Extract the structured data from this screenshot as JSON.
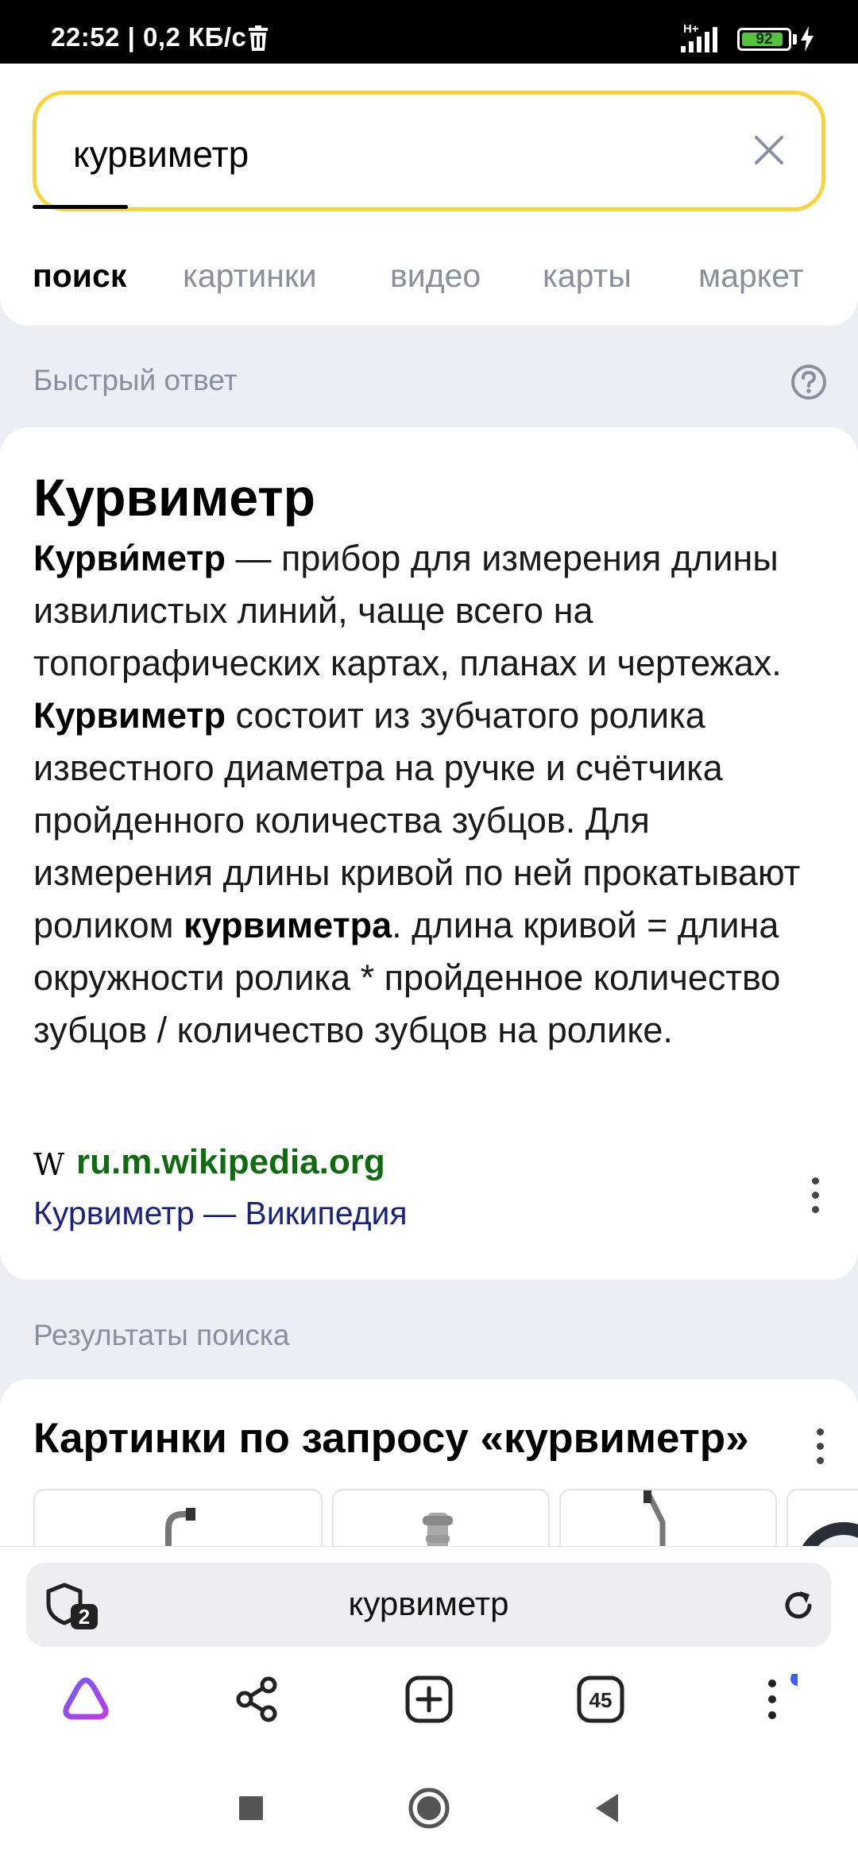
{
  "status_bar": {
    "time_speed": "22:52 | 0,2 КБ/с",
    "network": "H+",
    "battery_percent": "92",
    "battery_level": 0.92,
    "icons": [
      "trash-icon",
      "signal-icon",
      "battery-icon",
      "charging-icon"
    ]
  },
  "search": {
    "query": "курвиметр",
    "clear_icon": "close-icon"
  },
  "tabs": [
    {
      "label": "поиск",
      "active": true
    },
    {
      "label": "картинки",
      "active": false
    },
    {
      "label": "видео",
      "active": false
    },
    {
      "label": "карты",
      "active": false
    },
    {
      "label": "маркет",
      "active": false
    }
  ],
  "quick_answer": {
    "section_label": "Быстрый ответ",
    "title": "Курвиметр",
    "text_parts": [
      {
        "text": "Курви́метр",
        "bold": true
      },
      {
        "text": " — прибор для измерения длины извилистых линий, чаще всего на топографических картах, планах и чертежах. ",
        "bold": false
      },
      {
        "text": "Курвиметр",
        "bold": true
      },
      {
        "text": " состоит из зубчатого ролика известного диаметра на ручке и счётчика пройденного количества зубцов. Для измерения длины кривой по ней прокатывают роликом ",
        "bold": false
      },
      {
        "text": "курвиметра",
        "bold": true
      },
      {
        "text": ". длина кривой = длина окружности ролика * пройденное количество зубцов / количество зубцов на ролике.",
        "bold": false
      }
    ],
    "source_icon": "W",
    "source_domain": "ru.m.wikipedia.org",
    "source_title": "Курвиметр — Википедия"
  },
  "results": {
    "section_label": "Результаты поиска",
    "images_title": "Картинки по запросу «курвиметр»"
  },
  "browser": {
    "omnibox_text": "курвиметр",
    "shield_badge": "2",
    "tabs_count": "45",
    "accent_color": "#a24bf0",
    "notification_dot_color": "#3f5ff0"
  },
  "colors": {
    "search_border": "#f6d43a",
    "source_domain": "#0e6b0e",
    "source_title": "#1a237e",
    "muted": "#8a8f9c",
    "page_bg": "#edeef3"
  }
}
